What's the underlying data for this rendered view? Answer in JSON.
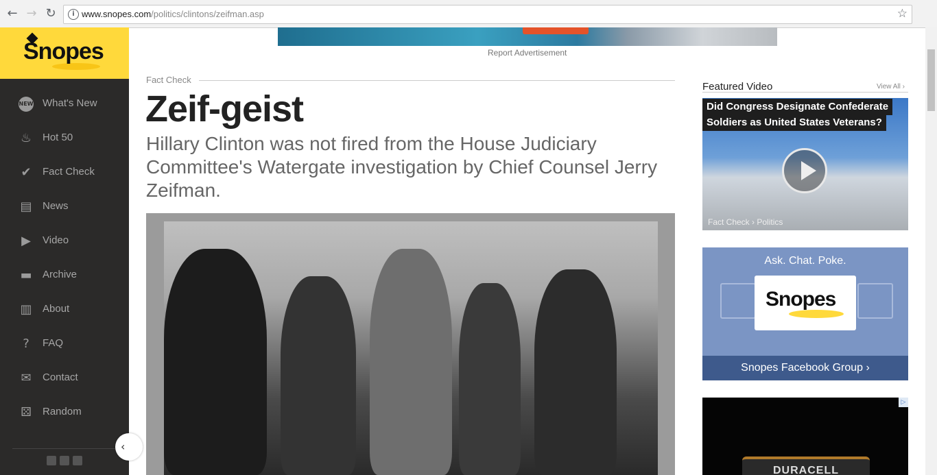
{
  "browser": {
    "url_host": "www.snopes.com",
    "url_path": "/politics/clintons/zeifman.asp"
  },
  "sidebar": {
    "logo_text": "Snopes",
    "items": [
      {
        "label": "What's New",
        "icon": "new-badge-icon"
      },
      {
        "label": "Hot 50",
        "icon": "flame-icon"
      },
      {
        "label": "Fact Check",
        "icon": "checkmark-circle-icon"
      },
      {
        "label": "News",
        "icon": "newspaper-icon"
      },
      {
        "label": "Video",
        "icon": "play-circle-icon"
      },
      {
        "label": "Archive",
        "icon": "archive-box-icon"
      },
      {
        "label": "About",
        "icon": "book-icon"
      },
      {
        "label": "FAQ",
        "icon": "question-icon"
      },
      {
        "label": "Contact",
        "icon": "envelope-icon"
      },
      {
        "label": "Random",
        "icon": "dice-icon"
      }
    ]
  },
  "ad": {
    "report_label": "Report Advertisement"
  },
  "article": {
    "kicker": "Fact Check",
    "title": "Zeif-geist",
    "subtitle": "Hillary Clinton was not fired from the House Judiciary Committee's Watergate investigation by Chief Counsel Jerry Zeifman."
  },
  "featured_video": {
    "heading": "Featured Video",
    "view_all": "View All ›",
    "caption_line1": "Did Congress Designate Confederate",
    "caption_line2": "Soldiers as United States Veterans?",
    "crumb": "Fact Check › Politics"
  },
  "facebook_promo": {
    "tagline": "Ask. Chat. Poke.",
    "logo_text": "Snopes",
    "link": "Snopes Facebook Group ›"
  },
  "ad2": {
    "brand": "DURACELL",
    "badge": "▷"
  }
}
